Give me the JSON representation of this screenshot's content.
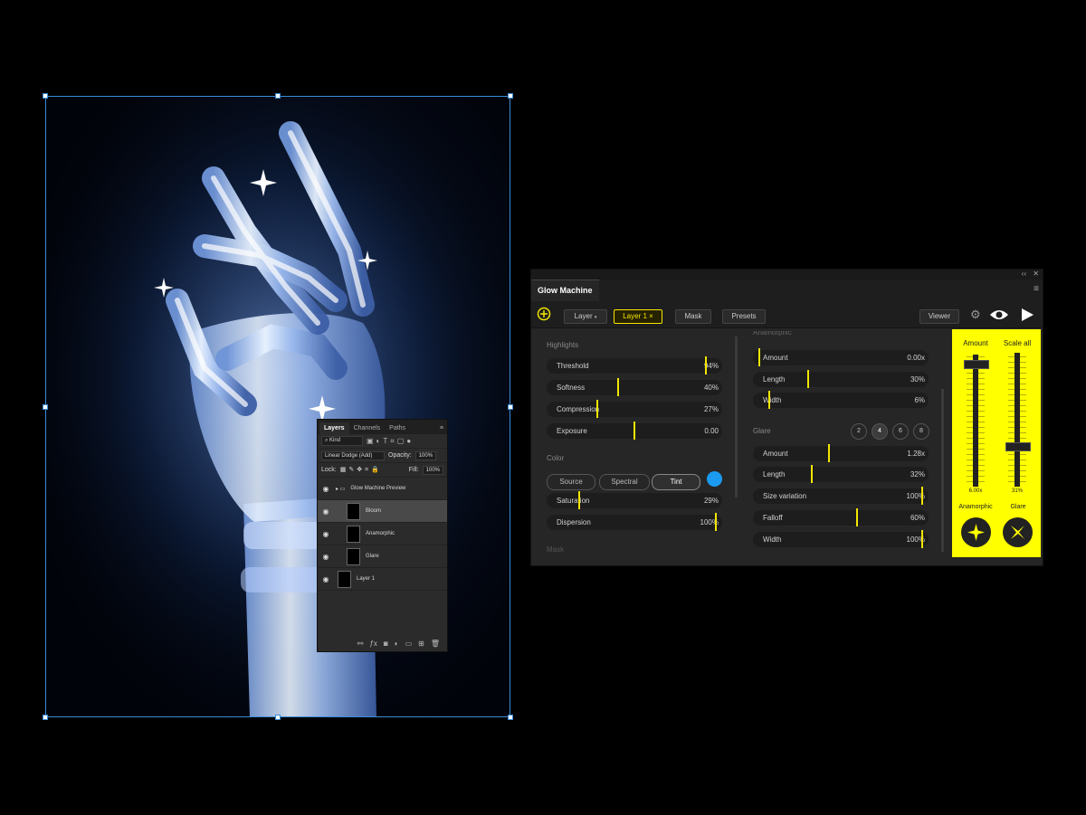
{
  "layers_panel": {
    "tabs": [
      "Layers",
      "Channels",
      "Paths"
    ],
    "kind_label": "Kind",
    "blend_mode": "Linear Dodge (Add)",
    "opacity_label": "Opacity:",
    "opacity_value": "100%",
    "lock_label": "Lock:",
    "fill_label": "Fill:",
    "fill_value": "100%",
    "group_name": "Glow Machine Preview",
    "layers": [
      {
        "name": "Bloom"
      },
      {
        "name": "Anamorphic"
      },
      {
        "name": "Glare"
      },
      {
        "name": "Layer 1"
      }
    ]
  },
  "glow_machine": {
    "title": "Glow Machine",
    "collapse_label": "‹‹",
    "close_label": "✕",
    "toolbar": {
      "layer_dropdown": "Layer",
      "layer_tag": "Layer 1 ×",
      "mask": "Mask",
      "presets": "Presets",
      "viewer": "Viewer"
    },
    "highlights": {
      "title": "Highlights",
      "sliders": [
        {
          "label": "Threshold",
          "value": "94%",
          "level": 0.94
        },
        {
          "label": "Softness",
          "value": "40%",
          "level": 0.4
        },
        {
          "label": "Compression",
          "value": "27%",
          "level": 0.27
        },
        {
          "label": "Exposure",
          "value": "0.00",
          "level": 0.5
        }
      ]
    },
    "color": {
      "title": "Color",
      "modes": [
        "Source",
        "Spectral",
        "Tint"
      ],
      "active_mode": "Tint",
      "tint_color": "#1a9bf0",
      "sliders": [
        {
          "label": "Saturation",
          "value": "29%",
          "level": 0.16
        },
        {
          "label": "Dispersion",
          "value": "100%",
          "level": 1.0
        }
      ]
    },
    "mask_title": "Mask",
    "anamorphic": {
      "title": "Anamorphic",
      "sliders": [
        {
          "label": "Amount",
          "value": "0.00x",
          "level": 0.0
        },
        {
          "label": "Length",
          "value": "30%",
          "level": 0.3
        },
        {
          "label": "Width",
          "value": "6%",
          "level": 0.06
        }
      ]
    },
    "glare": {
      "title": "Glare",
      "points": [
        "2",
        "4",
        "6",
        "8"
      ],
      "active_point": "4",
      "sliders": [
        {
          "label": "Amount",
          "value": "1.28x",
          "level": 0.43
        },
        {
          "label": "Length",
          "value": "32%",
          "level": 0.32
        },
        {
          "label": "Size variation",
          "value": "100%",
          "level": 1.0
        },
        {
          "label": "Falloff",
          "value": "60%",
          "level": 0.6
        },
        {
          "label": "Width",
          "value": "100%",
          "level": 1.0
        }
      ]
    },
    "master": {
      "amount_label": "Amount",
      "amount_value": "6.00x",
      "amount_level": 0.96,
      "scale_label": "Scale all",
      "scale_value": "31%",
      "scale_level": 0.31,
      "anamorphic_label": "Anamorphic",
      "glare_label": "Glare"
    },
    "accent_color": "#f3e600"
  }
}
